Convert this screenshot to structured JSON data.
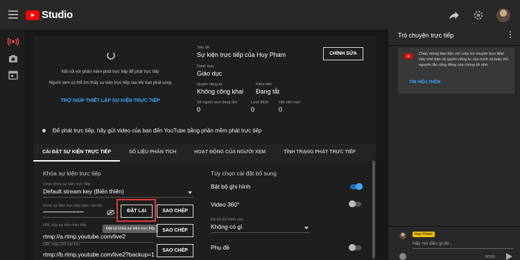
{
  "app": {
    "logo_text": "Studio"
  },
  "preview": {
    "line1": "Kết nối với phần mềm phát trực tiếp để phát trực tiếp",
    "line2": "Người xem có thể tìm thấy sự kiện trực tiếp sau khi bạn phát sóng",
    "help_link": "TRỢ GIÚP THIẾT LẬP SỰ KIỆN TRỰC TIẾP"
  },
  "stream_info": {
    "title_label": "Tiêu đề",
    "title": "Sự kiện trực tiếp của Huy Pham",
    "edit_button": "CHỈNH SỬA",
    "category_label": "Danh mục",
    "category": "Giáo dục",
    "privacy_label": "Quyền riêng tư",
    "privacy": "Không công khai",
    "monetization_label": "Kiếm tiền",
    "monetization": "Đang tắt",
    "viewers_waiting_label": "Số người xem đang đợi",
    "viewers_waiting": "0",
    "likes_label": "Lượt thích",
    "likes": "0",
    "members_label": "Hội viên mới",
    "members": "0"
  },
  "notice": "Để phát trực tiếp, hãy gửi video của bạn đến YouTube bằng phần mềm phát trực tiếp",
  "tabs": [
    {
      "label": "CÀI ĐẶT SỰ KIỆN TRỰC TIẾP",
      "active": true
    },
    {
      "label": "SỐ LIỆU PHÂN TÍCH",
      "active": false
    },
    {
      "label": "HOẠT ĐỘNG CỦA NGƯỜI XEM",
      "active": false
    },
    {
      "label": "TÌNH TRẠNG PHÁT TRỰC TIẾP",
      "active": false
    }
  ],
  "stream_key": {
    "section_title": "Khóa sự kiện trực tiếp",
    "select_label": "Chọn khóa sự kiện trực tiếp",
    "select_value": "Default stream key (Biến thiên)",
    "key_label": "Khóa sự kiện trực tiếp (dán vào bộ...",
    "key_value": "••••••••••••••••••••••••••••",
    "reset_button": "ĐẶT LẠI",
    "copy_button": "SAO CHÉP",
    "reset_tooltip": "Đặt lại khóa sự kiện trực tiếp",
    "url_label": "URL của sự kiện trực tiếp",
    "url_value": "rtmp://a.rtmp.youtube.com/live2",
    "backup_label": "URL máy chủ sao lưu",
    "backup_value": "rtmp://b.rtmp.youtube.com/live2?backup=1"
  },
  "additional": {
    "section_title": "Tùy chọn cài đặt bổ sung",
    "dvr_label": "Bật bộ ghi hình",
    "dvr_on": true,
    "video360_label": "Video 360°",
    "video360_on": false,
    "latency_label": "Độ trễ đã thêm vào",
    "latency_value": "Không có gì",
    "captions_label": "Phụ đề",
    "captions_on": false
  },
  "chat": {
    "title": "Trò chuyện trực tiếp",
    "welcome": "Chào mừng bạn đến với cuộc trò chuyện trực tiếp! Hãy nhớ bảo vệ quyền riêng tư của mình và tuân thủ nguyên tắc cộng đồng của chúng tôi nhé.",
    "learn_more": "TÌM HIỂU THÊM",
    "user_name": "Huy Pham",
    "input_placeholder": "Hãy nói điều gì đó...",
    "char_count": "0/200"
  },
  "colors": {
    "accent": "#3ea6ff",
    "brand": "#ff0000",
    "highlight": "#e53935"
  }
}
